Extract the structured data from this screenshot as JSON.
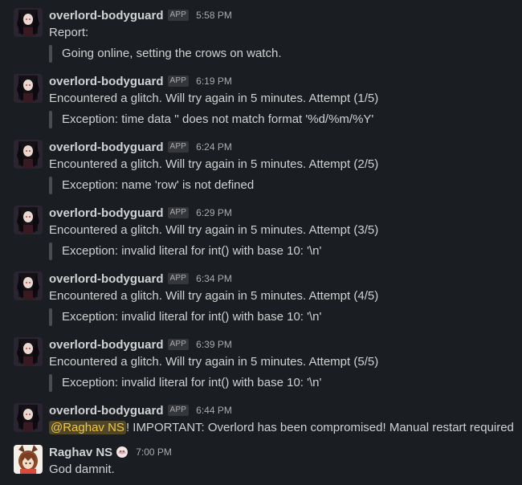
{
  "messages": [
    {
      "author": "overlord-bodyguard",
      "badge": "APP",
      "time": "5:58 PM",
      "text": "Report:",
      "quote": "Going online, setting the crows on watch."
    },
    {
      "author": "overlord-bodyguard",
      "badge": "APP",
      "time": "6:19 PM",
      "text": "Encountered a glitch. Will try again in 5 minutes. Attempt (1/5)",
      "quote": "Exception: time data '' does not match format '%d/%m/%Y'"
    },
    {
      "author": "overlord-bodyguard",
      "badge": "APP",
      "time": "6:24 PM",
      "text": "Encountered a glitch. Will try again in 5 minutes. Attempt (2/5)",
      "quote": "Exception: name 'row' is not defined"
    },
    {
      "author": "overlord-bodyguard",
      "badge": "APP",
      "time": "6:29 PM",
      "text": "Encountered a glitch. Will try again in 5 minutes. Attempt (3/5)",
      "quote": "Exception: invalid literal for int() with base 10: '\\n'"
    },
    {
      "author": "overlord-bodyguard",
      "badge": "APP",
      "time": "6:34 PM",
      "text": "Encountered a glitch. Will try again in 5 minutes. Attempt (4/5)",
      "quote": "Exception: invalid literal for int() with base 10: '\\n'"
    },
    {
      "author": "overlord-bodyguard",
      "badge": "APP",
      "time": "6:39 PM",
      "text": "Encountered a glitch. Will try again in 5 minutes. Attempt (5/5)",
      "quote": "Exception: invalid literal for int() with base 10: '\\n'"
    },
    {
      "author": "overlord-bodyguard",
      "badge": "APP",
      "time": "6:44 PM",
      "mention": "@Raghav NS",
      "text_after_mention": "! IMPORTANT: Overlord has been compromised! Manual restart required"
    },
    {
      "author": "Raghav NS",
      "status_emoji_icon": "status-emoji-icon",
      "time": "7:00 PM",
      "text": "God damnit."
    }
  ],
  "colors": {
    "background": "#1a1d21",
    "text": "#d1d2d3",
    "muted": "#ababad",
    "quote_bar": "#4a4d52",
    "mention": "#f2c744"
  }
}
